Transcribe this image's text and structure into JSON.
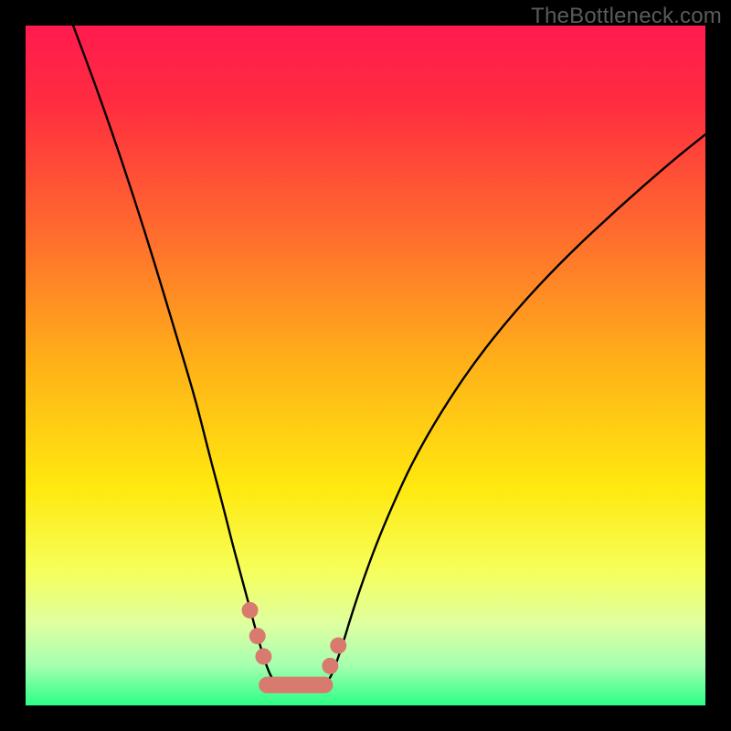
{
  "watermark": "TheBottleneck.com",
  "chart_data": {
    "type": "line",
    "title": "",
    "xlabel": "",
    "ylabel": "",
    "x_range": [
      0,
      100
    ],
    "y_range": [
      0,
      100
    ],
    "gradient_stops": [
      {
        "offset": 0.0,
        "color": "#ff1a4f"
      },
      {
        "offset": 0.12,
        "color": "#ff2e3f"
      },
      {
        "offset": 0.3,
        "color": "#ff6a2f"
      },
      {
        "offset": 0.5,
        "color": "#ffb218"
      },
      {
        "offset": 0.68,
        "color": "#ffe90f"
      },
      {
        "offset": 0.8,
        "color": "#f6ff5a"
      },
      {
        "offset": 0.88,
        "color": "#dfffa0"
      },
      {
        "offset": 0.94,
        "color": "#a7ffb0"
      },
      {
        "offset": 1.0,
        "color": "#2bff86"
      }
    ],
    "series": [
      {
        "name": "left-branch",
        "x": [
          7,
          10,
          13,
          16,
          19,
          22,
          25,
          27,
          29,
          30.5,
          32,
          33.2,
          34.3,
          35.2,
          36.0,
          36.8
        ],
        "y": [
          100,
          92,
          83.5,
          74.5,
          65,
          55,
          45,
          37,
          29.5,
          23.5,
          18,
          13.5,
          9.5,
          6.5,
          4.4,
          3.2
        ]
      },
      {
        "name": "right-branch",
        "x": [
          44.2,
          45.0,
          45.8,
          46.8,
          48.0,
          49.5,
          51.5,
          54,
          57,
          61,
          66,
          72,
          79,
          87,
          95,
          100
        ],
        "y": [
          3.2,
          4.4,
          6.5,
          9.5,
          13.5,
          18,
          23.5,
          29.5,
          36,
          43,
          50.5,
          58,
          65.5,
          73,
          80,
          84
        ]
      }
    ],
    "flat_bottom": {
      "x_start": 36.8,
      "x_end": 44.2,
      "y": 3.2
    },
    "markers": {
      "color": "#d97a6e",
      "radius_px": 9,
      "left_cluster_x": [
        33.0,
        34.1,
        35.0
      ],
      "left_cluster_y": [
        14.0,
        10.2,
        7.2
      ],
      "right_cluster_x": [
        44.8,
        46.0
      ],
      "right_cluster_y": [
        5.8,
        8.8
      ],
      "bottom_bar": {
        "x_start": 35.5,
        "x_end": 44.0,
        "y": 3.0,
        "thickness_px": 18
      }
    }
  }
}
